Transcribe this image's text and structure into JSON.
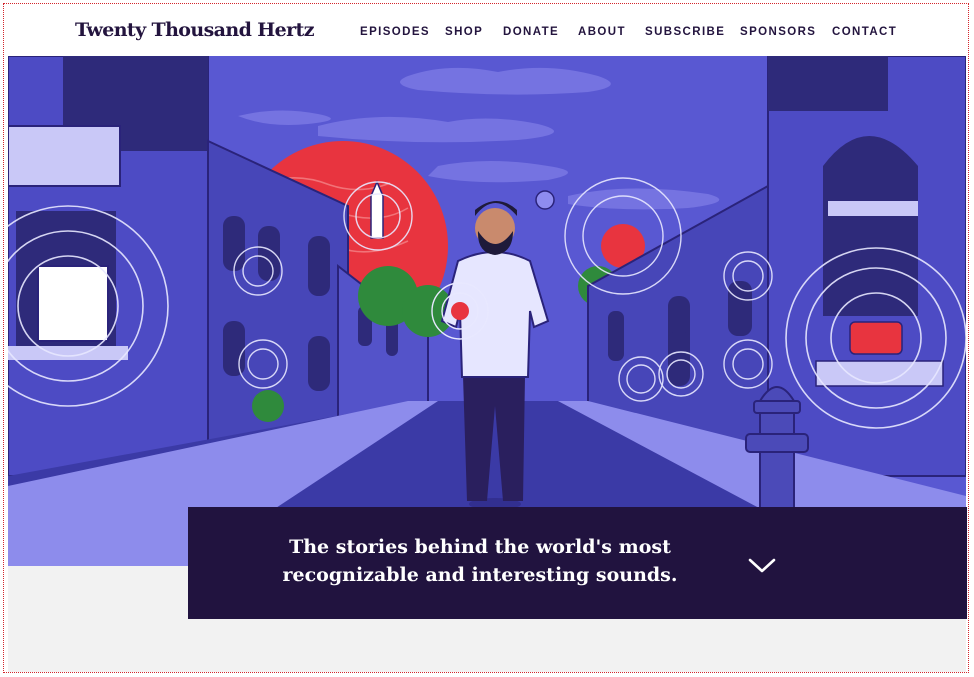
{
  "site": {
    "logo_text": "Twenty Thousand Hertz"
  },
  "nav": {
    "items": [
      {
        "label": "EPISODES"
      },
      {
        "label": "SHOP"
      },
      {
        "label": "DONATE"
      },
      {
        "label": "ABOUT"
      },
      {
        "label": "SUBSCRIBE"
      },
      {
        "label": "SPONSORS"
      },
      {
        "label": "CONTACT"
      }
    ]
  },
  "hero": {
    "tagline_line1": "The stories behind the world's most",
    "tagline_line2": "recognizable and interesting sounds.",
    "scroll_icon": "chevron-down-icon"
  },
  "colors": {
    "brand_dark": "#21133f",
    "logo_text": "#23143e",
    "hero_purple": "#5b5ad4",
    "accent_red": "#e8343f",
    "foliage_green": "#2f8a3c",
    "page_bg": "#f2f2f2"
  }
}
